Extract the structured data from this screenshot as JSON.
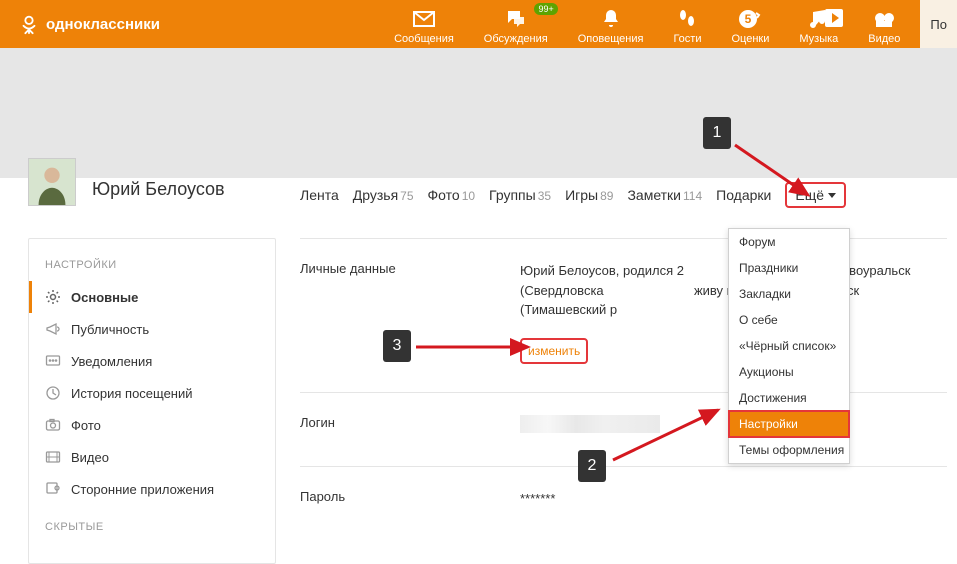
{
  "header": {
    "logo_text": "одноклассники",
    "nav": [
      {
        "name": "messages",
        "label": "Сообщения"
      },
      {
        "name": "discussions",
        "label": "Обсуждения",
        "badge": "99+"
      },
      {
        "name": "notifications",
        "label": "Оповещения"
      },
      {
        "name": "guests",
        "label": "Гости"
      },
      {
        "name": "ratings",
        "label": "Оценки"
      },
      {
        "name": "music",
        "label": "Музыка"
      },
      {
        "name": "video",
        "label": "Видео"
      }
    ],
    "right_button": "По"
  },
  "profile": {
    "name": "Юрий Белоусов"
  },
  "tabs": [
    {
      "label": "Лента"
    },
    {
      "label": "Друзья",
      "count": "75"
    },
    {
      "label": "Фото",
      "count": "10"
    },
    {
      "label": "Группы",
      "count": "35"
    },
    {
      "label": "Игры",
      "count": "89"
    },
    {
      "label": "Заметки",
      "count": "114"
    },
    {
      "label": "Подарки"
    }
  ],
  "more_label": "Ещё",
  "dropdown": [
    "Форум",
    "Праздники",
    "Закладки",
    "О себе",
    "«Чёрный список»",
    "Аукционы",
    "Достижения",
    "Настройки",
    "Темы оформления"
  ],
  "sidebar": {
    "heading": "НАСТРОЙКИ",
    "items": [
      {
        "label": "Основные",
        "name": "main",
        "active": true
      },
      {
        "label": "Публичность",
        "name": "publicity"
      },
      {
        "label": "Уведомления",
        "name": "notify"
      },
      {
        "label": "История посещений",
        "name": "history"
      },
      {
        "label": "Фото",
        "name": "photo"
      },
      {
        "label": "Видео",
        "name": "video"
      },
      {
        "label": "Сторонние приложения",
        "name": "apps"
      }
    ],
    "heading2": "СКРЫТЫЕ"
  },
  "content": {
    "personal": {
      "label": "Личные данные",
      "text": "Юрий Белоусов, родился 2                          городе г. Новоуральск (Свердловска                         живу в городе г. Тимашевск (Тимашевский р",
      "change": "изменить"
    },
    "login": {
      "label": "Логин"
    },
    "password": {
      "label": "Пароль",
      "masked": "*******"
    }
  },
  "annotations": {
    "a1": "1",
    "a2": "2",
    "a3": "3"
  },
  "colors": {
    "brand": "#ee8208",
    "highlight": "#e4363a"
  }
}
